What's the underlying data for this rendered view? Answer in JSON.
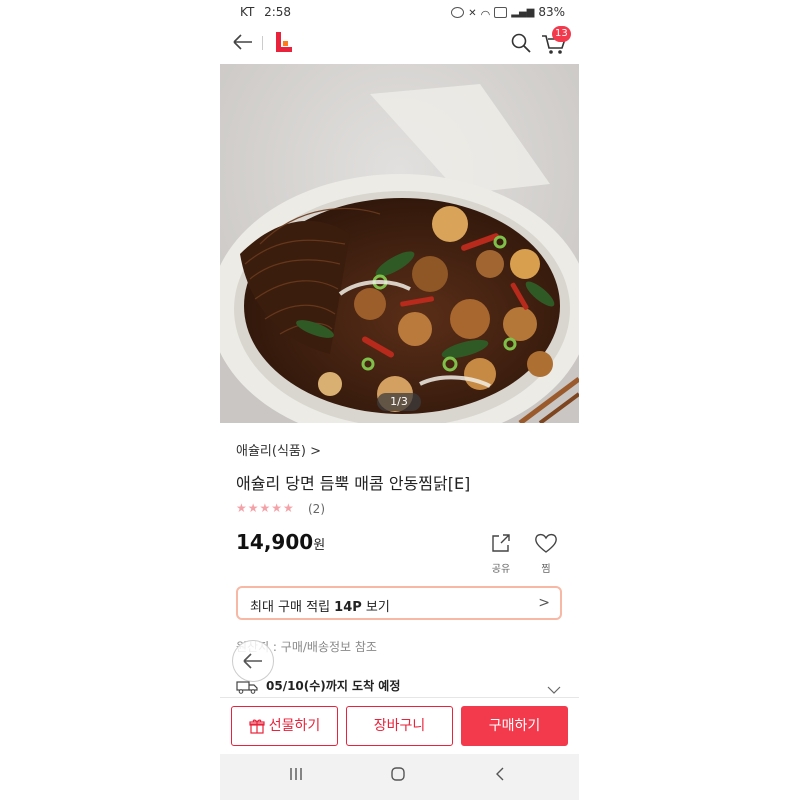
{
  "status_bar": {
    "carrier": "KT",
    "time": "2:58",
    "battery": "83%"
  },
  "header": {
    "cart_count": "13"
  },
  "image": {
    "counter": "1/3"
  },
  "product": {
    "brand": "애슐리(식품) >",
    "title": "애슐리 당면 듬뿍 매콤 안동찜닭[E]",
    "stars": "★★★★★",
    "review_count": "(2)",
    "price": "14,900",
    "price_unit": "원",
    "share_label": "공유",
    "wish_label": "찜"
  },
  "points": {
    "text_prefix": "최대 구매 적립 ",
    "text_points": "14P",
    "text_suffix": " 보기",
    "chevron": ">"
  },
  "info": {
    "origin": "원산지 : 구매/배송정보 참조",
    "delivery": "05/10(수)까지 도착 예정"
  },
  "actions": {
    "gift": "선물하기",
    "cart": "장바구니",
    "buy": "구매하기"
  },
  "colors": {
    "accent": "#f23a4c",
    "brand_red": "#e8233b",
    "logo_orange": "#ff7a1a",
    "points_border": "#f7b8a6",
    "stars": "#f4a2a7"
  }
}
